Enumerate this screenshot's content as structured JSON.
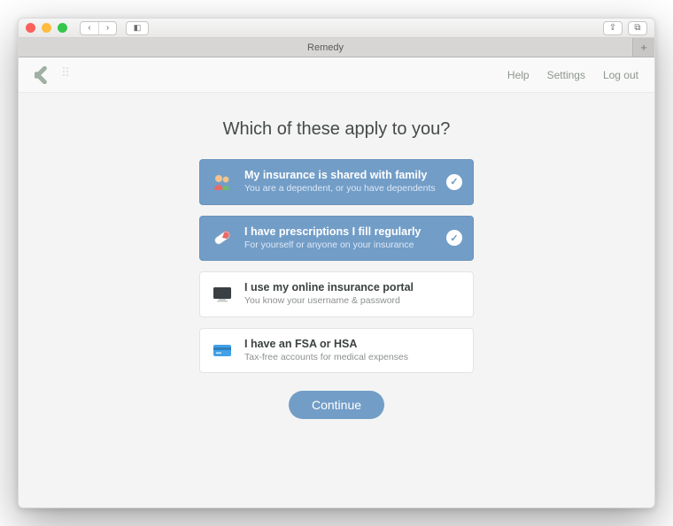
{
  "window": {
    "tab_title": "Remedy",
    "icons": {
      "back": "‹",
      "forward": "›",
      "sidebar": "◧",
      "share": "⇪",
      "tabs": "⧉",
      "newtab": "+"
    }
  },
  "app": {
    "nav": {
      "help": "Help",
      "settings": "Settings",
      "logout": "Log out"
    }
  },
  "page": {
    "heading": "Which of these apply to you?",
    "continue_label": "Continue"
  },
  "options": [
    {
      "id": "family",
      "title": "My insurance is shared with family",
      "subtitle": "You are a dependent, or you have dependents",
      "selected": true,
      "icon": "family-icon"
    },
    {
      "id": "rx",
      "title": "I have prescriptions I fill regularly",
      "subtitle": "For yourself or anyone on your insurance",
      "selected": true,
      "icon": "pill-icon"
    },
    {
      "id": "portal",
      "title": "I use my online insurance portal",
      "subtitle": "You know your username & password",
      "selected": false,
      "icon": "monitor-icon"
    },
    {
      "id": "fsa",
      "title": "I have an FSA or HSA",
      "subtitle": "Tax-free accounts for medical expenses",
      "selected": false,
      "icon": "card-icon"
    }
  ]
}
